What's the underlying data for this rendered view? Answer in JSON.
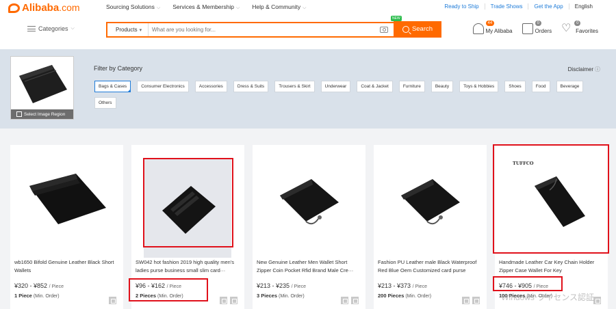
{
  "header": {
    "logo_text": "Alibaba",
    "logo_suffix": ".com",
    "nav": [
      "Sourcing Solutions",
      "Services & Membership",
      "Help & Community"
    ],
    "right_links": [
      "Ready to Ship",
      "Trade Shows",
      "Get the App",
      "English"
    ],
    "categories_label": "Categories",
    "search": {
      "category": "Products",
      "placeholder": "What are you looking for...",
      "button": "Search",
      "new_badge": "NEW"
    },
    "user": {
      "my_alibaba": "My Alibaba",
      "my_alibaba_badge": "44",
      "orders": "Orders",
      "orders_badge": "0",
      "favorites": "Favorites",
      "favorites_badge": "0"
    }
  },
  "filter": {
    "select_region": "Select Image Region",
    "title": "Filter by Category",
    "disclaimer": "Disclaimer",
    "chips": [
      "Bags & Cases",
      "Consumer Electronics",
      "Accessories",
      "Dress & Suits",
      "Trousers & Skirt",
      "Underwear",
      "Coat & Jacket",
      "Furniture",
      "Beauty",
      "Toys & Hobbies",
      "Shoes",
      "Food",
      "Beverage",
      "Others"
    ],
    "active_chip": "Bags & Cases"
  },
  "products": [
    {
      "title": "wb1650 Bifold Genuine Leather Black Short Wallets",
      "price": "¥320 - ¥852",
      "unit": "/ Piece",
      "moq": "1 Piece",
      "moq_suffix": "(Min. Order)"
    },
    {
      "title": "SW042 hot fashion 2019 high quality men's ladies purse business small slim card···",
      "price": "¥96 - ¥162",
      "unit": "/ Piece",
      "moq": "2 Pieces",
      "moq_suffix": "(Min. Order)"
    },
    {
      "title": "New Genuine Leather Men Wallet Short Zipper Coin Pocket Rfid Brand Male Cre···",
      "price": "¥213 - ¥235",
      "unit": "/ Piece",
      "moq": "3 Pieces",
      "moq_suffix": "(Min. Order)"
    },
    {
      "title": "Fashion PU Leather male Black Waterproof Red Blue Oem Customized card purse",
      "price": "¥213 - ¥373",
      "unit": "/ Piece",
      "moq": "200 Pieces",
      "moq_suffix": "(Min. Order)"
    },
    {
      "title": "Handmade Leather Car Key Chain Holder Zipper Case Wallet For Key",
      "price": "¥746 - ¥905",
      "unit": "/ Piece",
      "moq": "100 Pieces",
      "moq_suffix": "(Min. Order)",
      "brand": "TUFFCO"
    }
  ],
  "watermark": "Windows ライセンス認証",
  "colors": {
    "brand": "#ff6a00",
    "link": "#1e7bd8",
    "highlight": "#e0101a"
  }
}
